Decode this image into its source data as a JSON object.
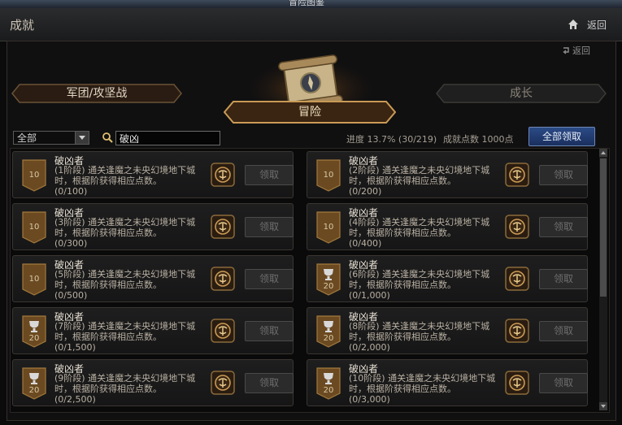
{
  "window": {
    "title": "冒险图鉴"
  },
  "header": {
    "title": "成就",
    "back_label": "返回"
  },
  "sub_back_label": "返回",
  "tabs": {
    "left": "军团/攻坚战",
    "center": "冒险",
    "right": "成长"
  },
  "filter": {
    "selected": "全部"
  },
  "search": {
    "value": "破凶"
  },
  "stats": {
    "progress_text": "进度 13.7% (30/219)",
    "points_text": "成就点数 1000点"
  },
  "claim_all_label": "全部领取",
  "achievements": [
    {
      "title": "破凶者",
      "desc": "(1阶段) 通关逢魔之未央幻境地下城时，根据阶获得相应点数。",
      "progress": "(0/100)",
      "points": "10",
      "claim": "领取"
    },
    {
      "title": "破凶者",
      "desc": "(2阶段) 通关逢魔之未央幻境地下城时，根据阶获得相应点数。",
      "progress": "(0/200)",
      "points": "10",
      "claim": "领取"
    },
    {
      "title": "破凶者",
      "desc": "(3阶段) 通关逢魔之未央幻境地下城时，根据阶获得相应点数。",
      "progress": "(0/300)",
      "points": "10",
      "claim": "领取"
    },
    {
      "title": "破凶者",
      "desc": "(4阶段) 通关逢魔之未央幻境地下城时，根据阶获得相应点数。",
      "progress": "(0/400)",
      "points": "10",
      "claim": "领取"
    },
    {
      "title": "破凶者",
      "desc": "(5阶段) 通关逢魔之未央幻境地下城时，根据阶获得相应点数。",
      "progress": "(0/500)",
      "points": "10",
      "claim": "领取"
    },
    {
      "title": "破凶者",
      "desc": "(6阶段) 通关逢魔之未央幻境地下城时，根据阶获得相应点数。",
      "progress": "(0/1,000)",
      "points": "20",
      "claim": "领取"
    },
    {
      "title": "破凶者",
      "desc": "(7阶段) 通关逢魔之未央幻境地下城时，根据阶获得相应点数。",
      "progress": "(0/1,500)",
      "points": "20",
      "claim": "领取"
    },
    {
      "title": "破凶者",
      "desc": "(8阶段) 通关逢魔之未央幻境地下城时，根据阶获得相应点数。",
      "progress": "(0/2,000)",
      "points": "20",
      "claim": "领取"
    },
    {
      "title": "破凶者",
      "desc": "(9阶段) 通关逢魔之未央幻境地下城时，根据阶获得相应点数。",
      "progress": "(0/2,500)",
      "points": "20",
      "claim": "领取"
    },
    {
      "title": "破凶者",
      "desc": "(10阶段) 通关逢魔之未央幻境地下城时，根据阶获得相应点数。",
      "progress": "(0/3,000)",
      "points": "20",
      "claim": "领取"
    }
  ],
  "colors": {
    "gold": "#c9a45a",
    "badge": "#6b4a22",
    "button_blue": "#1f3a72",
    "reward_icon": "#a07a35"
  },
  "icons": {
    "home": "home-icon",
    "back": "back-arrow-icon",
    "search": "search-icon",
    "scroll": "scroll-emblem-icon",
    "reward": "reward-chest-icon",
    "trophy": "trophy-icon"
  }
}
